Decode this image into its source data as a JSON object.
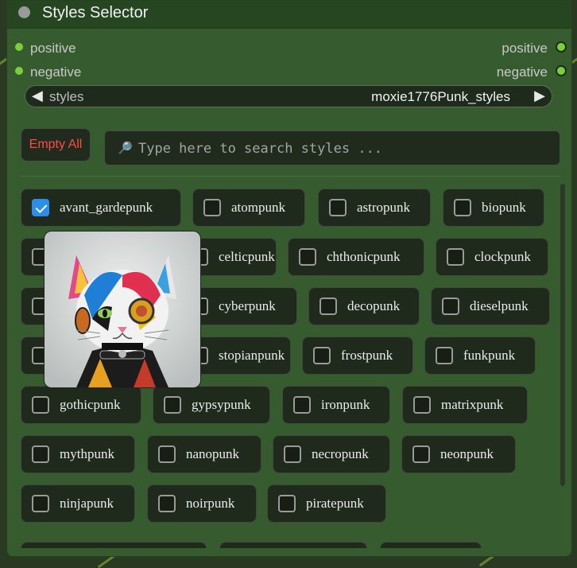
{
  "node": {
    "title": "Styles Selector",
    "inputs": [
      "positive",
      "negative"
    ],
    "outputs": [
      "positive",
      "negative"
    ]
  },
  "combo": {
    "label": "styles",
    "value": "moxie1776Punk_styles",
    "prev_icon": "triangle-left-icon",
    "next_icon": "triangle-right-icon"
  },
  "empty_all_label": "Empty All",
  "search": {
    "placeholder": "Type here to search styles ...",
    "icon": "magnifier-icon"
  },
  "styles": [
    {
      "label": "avant_gardepunk",
      "checked": true
    },
    {
      "label": "atompunk",
      "checked": false
    },
    {
      "label": "astropunk",
      "checked": false
    },
    {
      "label": "biopunk",
      "checked": false
    },
    {
      "label": "celticpunk",
      "checked": false
    },
    {
      "label": "chthonicpunk",
      "checked": false
    },
    {
      "label": "clockpunk",
      "checked": false
    },
    {
      "label": "cyberpunk",
      "checked": false
    },
    {
      "label": "decopunk",
      "checked": false
    },
    {
      "label": "dieselpunk",
      "checked": false
    },
    {
      "label": "stopianpunk",
      "checked": false
    },
    {
      "label": "frostpunk",
      "checked": false
    },
    {
      "label": "funkpunk",
      "checked": false
    },
    {
      "label": "gothicpunk",
      "checked": false
    },
    {
      "label": "gypsypunk",
      "checked": false
    },
    {
      "label": "ironpunk",
      "checked": false
    },
    {
      "label": "matrixpunk",
      "checked": false
    },
    {
      "label": "mythpunk",
      "checked": false
    },
    {
      "label": "nanopunk",
      "checked": false
    },
    {
      "label": "necropunk",
      "checked": false
    },
    {
      "label": "neonpunk",
      "checked": false
    },
    {
      "label": "ninjapunk",
      "checked": false
    },
    {
      "label": "noirpunk",
      "checked": false
    },
    {
      "label": "piratepunk",
      "checked": false
    }
  ],
  "colors": {
    "node_bg": "#355b2e",
    "title_bg": "#264521",
    "accent_check": "#2d8ee8",
    "empty_all_text": "#ff4a4a",
    "slot_dot": "#7ccf3a"
  }
}
